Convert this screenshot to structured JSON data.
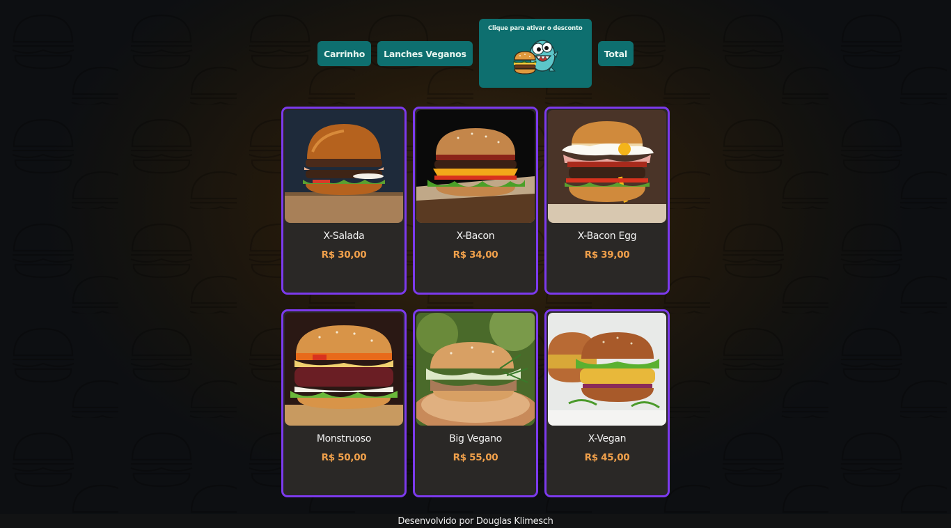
{
  "nav": {
    "cart_label": "Carrinho",
    "vegan_label": "Lanches Veganos",
    "discount_label": "Clique para ativar o desconto",
    "total_label": "Total"
  },
  "colors": {
    "nav_bg": "#0e6f6f",
    "card_border": "#7c3aed",
    "card_bg": "#2a2826",
    "price": "#f0a04b"
  },
  "products": [
    {
      "name": "X-Salada",
      "price": "R$ 30,00",
      "image": "burger-salad-photo"
    },
    {
      "name": "X-Bacon",
      "price": "R$ 34,00",
      "image": "burger-bacon-photo"
    },
    {
      "name": "X-Bacon Egg",
      "price": "R$ 39,00",
      "image": "burger-bacon-egg-photo"
    },
    {
      "name": "Monstruoso",
      "price": "R$ 50,00",
      "image": "burger-monster-photo"
    },
    {
      "name": "Big Vegano",
      "price": "R$ 55,00",
      "image": "burger-big-vegan-photo"
    },
    {
      "name": "X-Vegan",
      "price": "R$ 45,00",
      "image": "burger-x-vegan-photo"
    }
  ],
  "footer": {
    "text": "Desenvolvido por Douglas Klimesch"
  }
}
